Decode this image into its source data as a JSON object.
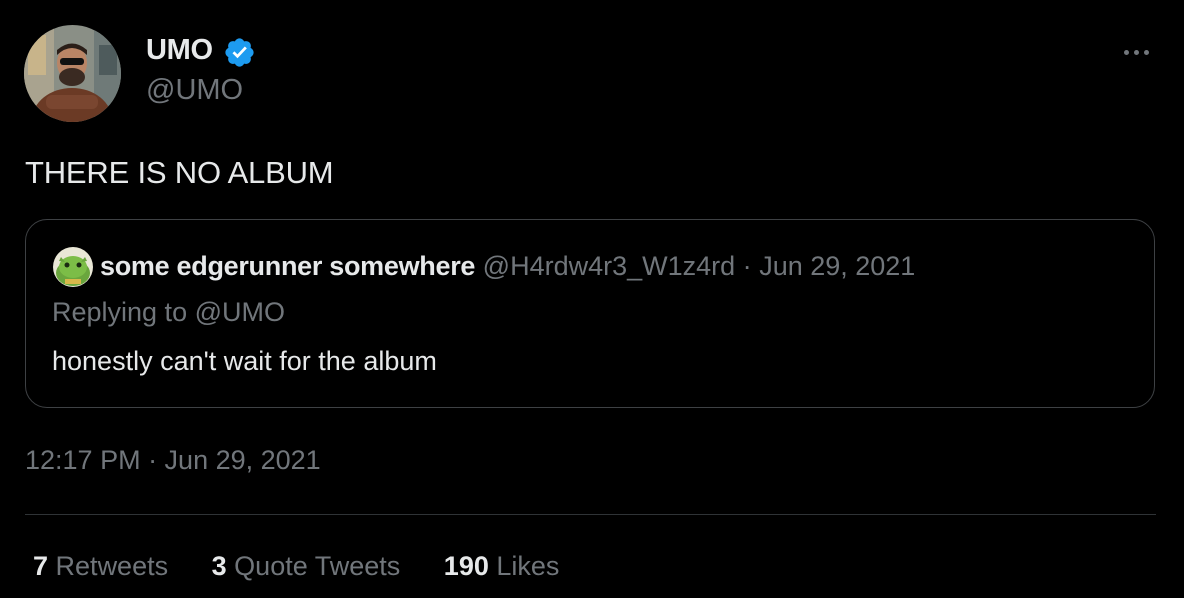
{
  "tweet": {
    "author": {
      "name": "UMO",
      "handle": "@UMO",
      "verified": true
    },
    "text": "THERE IS NO ALBUM",
    "quoted": {
      "name": "some edgerunner somewhere",
      "handle": "@H4rdw4r3_W1z4rd",
      "separator": "·",
      "date": "Jun 29, 2021",
      "replying_to": "Replying to @UMO",
      "text": "honestly can't wait for the album"
    },
    "timestamp": "12:17 PM · Jun 29, 2021",
    "stats": {
      "retweets": {
        "count": "7",
        "label": "Retweets"
      },
      "quote_tweets": {
        "count": "3",
        "label": "Quote Tweets"
      },
      "likes": {
        "count": "190",
        "label": "Likes"
      }
    }
  },
  "icons": {
    "verified": "verified-badge-icon",
    "more": "more-options-icon"
  },
  "colors": {
    "background": "#000000",
    "text_primary": "#e7e9ea",
    "text_secondary": "#71767b",
    "verified_blue": "#1d9bf0",
    "border": "#3e4144"
  }
}
